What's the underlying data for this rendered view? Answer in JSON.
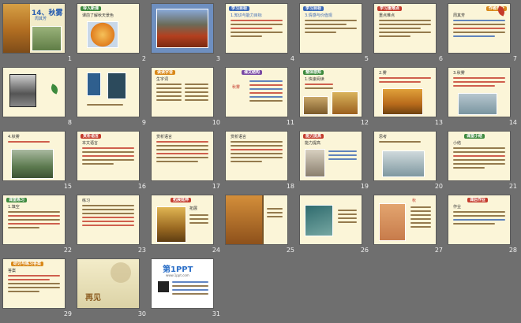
{
  "slides": [
    {
      "num": "1",
      "title": "14、秋雾",
      "subtitle": "周其芳"
    },
    {
      "num": "2",
      "tag": "导入新课",
      "text": "课前了解秋天景色"
    },
    {
      "num": "3"
    },
    {
      "num": "4",
      "tag": "学习目标",
      "text": "1.知识与能力目标"
    },
    {
      "num": "5",
      "tag": "学习目标",
      "text": "3.情感与价值观"
    },
    {
      "num": "6",
      "tag": "学习重难点",
      "text": "重点难点"
    },
    {
      "num": "7",
      "tag": "作者简介",
      "text": "周其芳"
    },
    {
      "num": "8"
    },
    {
      "num": "9"
    },
    {
      "num": "10",
      "tag": "读读字音",
      "text": "生字词"
    },
    {
      "num": "11",
      "tag": "课文结构",
      "text": "秋雾"
    },
    {
      "num": "12",
      "tag": "整体感知",
      "text": "1.快速阅读"
    },
    {
      "num": "13",
      "text": "2.雾"
    },
    {
      "num": "14",
      "text": "3.秋雾"
    },
    {
      "num": "15",
      "text": "4.秋雾"
    },
    {
      "num": "16",
      "tag": "赏析语言",
      "text": "本文语言"
    },
    {
      "num": "17",
      "text": "赏析语言"
    },
    {
      "num": "18",
      "text": "赏析语言"
    },
    {
      "num": "19",
      "tag": "能力提高",
      "text": "能力提高"
    },
    {
      "num": "20",
      "text": "思考"
    },
    {
      "num": "21",
      "tag": "课堂小结",
      "text": "小结"
    },
    {
      "num": "22",
      "tag": "课堂练习",
      "text": "1.填空"
    },
    {
      "num": "23",
      "text": "练习"
    },
    {
      "num": "24",
      "tag": "拓展延伸",
      "text": "拓展"
    },
    {
      "num": "25"
    },
    {
      "num": "26"
    },
    {
      "num": "27",
      "text": "秋"
    },
    {
      "num": "28",
      "tag": "课后作业",
      "text": "作业"
    },
    {
      "num": "29",
      "tag": "研讨与练习答案",
      "text": "答案"
    },
    {
      "num": "30",
      "text": "再见"
    },
    {
      "num": "31",
      "text": "第1PPT",
      "subtext": "www.1ppt.com"
    }
  ],
  "colors": {
    "accent": "#d9891a",
    "background": "#6f6f6f",
    "slide_bg": "#fbf5d8"
  }
}
